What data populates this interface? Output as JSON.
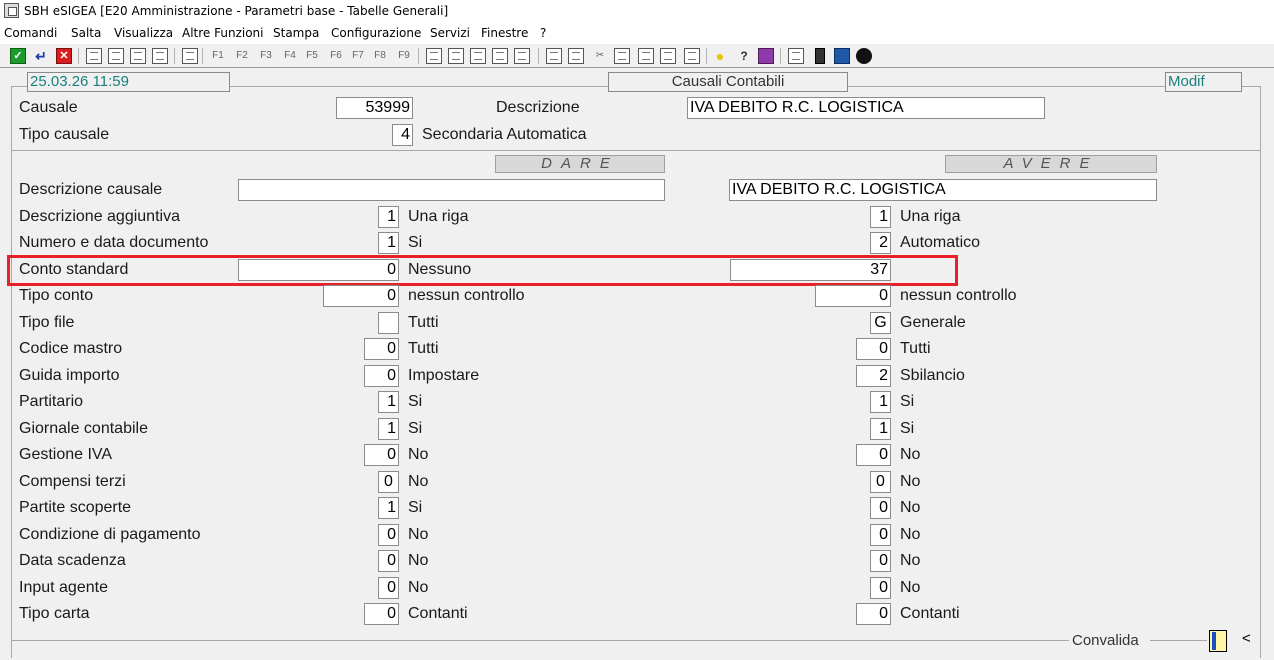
{
  "window": {
    "title": "SBH eSIGEA [E20 Amministrazione - Parametri base - Tabelle Generali]"
  },
  "menu": [
    "Comandi",
    "Salta",
    "Visualizza",
    "Altre Funzioni",
    "Stampa",
    "Configurazione",
    "Servizi",
    "Finestre",
    "?"
  ],
  "toolbar": {
    "icons": [
      "confirm-icon",
      "return-icon",
      "cancel-icon",
      "document-icon",
      "list-icon",
      "edit-icon",
      "page-icon",
      "export-icon",
      "f1-icon",
      "f2-icon",
      "f3-icon",
      "f4-icon",
      "f5-icon",
      "f6-icon",
      "f7-icon",
      "f8-icon",
      "f9-icon",
      "grid-icon",
      "print-icon",
      "print-preview-icon",
      "excel-icon",
      "table-icon",
      "tools-icon",
      "bulb-icon",
      "help-icon",
      "book-icon",
      "notepad-icon",
      "phone-icon",
      "calculator-icon",
      "globe-icon"
    ],
    "f_labels": [
      "F1",
      "F2",
      "F3",
      "F4",
      "F5",
      "F6",
      "F7",
      "F8",
      "F9"
    ],
    "colors": {
      "confirm": "#1e9b2d",
      "cancel": "#d81e1e"
    }
  },
  "header": {
    "datetime": "25.03.26 11:59",
    "form_title": "Causali Contabili",
    "mode": "Modif"
  },
  "causale": {
    "label": "Causale",
    "value": "53999",
    "descr_label": "Descrizione",
    "descr_value": "IVA DEBITO R.C. LOGISTICA",
    "tipo_label": "Tipo causale",
    "tipo_value": "4",
    "tipo_text": "Secondaria Automatica"
  },
  "sections": {
    "dare": "DARE",
    "avere": "AVERE"
  },
  "rows": [
    {
      "label": "Descrizione causale",
      "dare_value": "",
      "dare_text": "",
      "avere_value": "IVA DEBITO R.C. LOGISTICA",
      "avere_text": ""
    },
    {
      "label": "Descrizione aggiuntiva",
      "dare_value": "1",
      "dare_text": "Una riga",
      "avere_value": "1",
      "avere_text": "Una riga"
    },
    {
      "label": "Numero e data documento",
      "dare_value": "1",
      "dare_text": "Si",
      "avere_value": "2",
      "avere_text": "Automatico"
    },
    {
      "label": "Conto standard",
      "dare_value": "0",
      "dare_text": "Nessuno",
      "avere_value": "37",
      "avere_text": ""
    },
    {
      "label": "Tipo conto",
      "dare_value": "0",
      "dare_text": "nessun controllo",
      "avere_value": "0",
      "avere_text": "nessun controllo"
    },
    {
      "label": "Tipo file",
      "dare_value": "",
      "dare_text": "Tutti",
      "avere_value": "G",
      "avere_text": "Generale"
    },
    {
      "label": "Codice mastro",
      "dare_value": "0",
      "dare_text": "Tutti",
      "avere_value": "0",
      "avere_text": "Tutti"
    },
    {
      "label": "Guida importo",
      "dare_value": "0",
      "dare_text": "Impostare",
      "avere_value": "2",
      "avere_text": "Sbilancio"
    },
    {
      "label": "Partitario",
      "dare_value": "1",
      "dare_text": "Si",
      "avere_value": "1",
      "avere_text": "Si"
    },
    {
      "label": "Giornale contabile",
      "dare_value": "1",
      "dare_text": "Si",
      "avere_value": "1",
      "avere_text": "Si"
    },
    {
      "label": "Gestione IVA",
      "dare_value": "0",
      "dare_text": "No",
      "avere_value": "0",
      "avere_text": "No"
    },
    {
      "label": "Compensi terzi",
      "dare_value": "0",
      "dare_text": "No",
      "avere_value": "0",
      "avere_text": "No"
    },
    {
      "label": "Partite scoperte",
      "dare_value": "1",
      "dare_text": "Si",
      "avere_value": "0",
      "avere_text": "No"
    },
    {
      "label": "Condizione di pagamento",
      "dare_value": "0",
      "dare_text": "No",
      "avere_value": "0",
      "avere_text": "No"
    },
    {
      "label": "Data scadenza",
      "dare_value": "0",
      "dare_text": "No",
      "avere_value": "0",
      "avere_text": "No"
    },
    {
      "label": "Input agente",
      "dare_value": "0",
      "dare_text": "No",
      "avere_value": "0",
      "avere_text": "No"
    },
    {
      "label": "Tipo carta",
      "dare_value": "0",
      "dare_text": "Contanti",
      "avere_value": "0",
      "avere_text": "Contanti"
    }
  ],
  "footer": {
    "convalida": "Convalida",
    "arrow": "<"
  },
  "highlight_color": "#e8202a"
}
